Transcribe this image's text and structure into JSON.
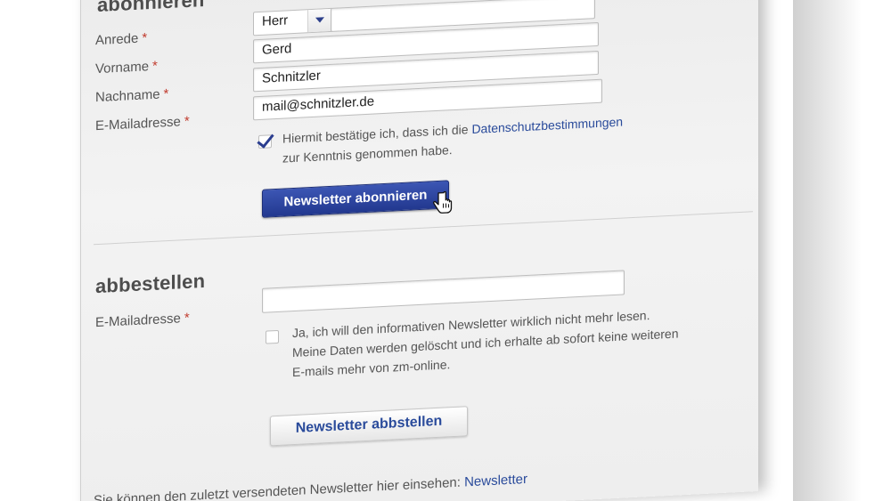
{
  "subscribe": {
    "title": "abonnieren",
    "salutation_label": "Anrede",
    "salutation_value": "Herr",
    "firstname_label": "Vorname",
    "firstname_value": "Gerd",
    "lastname_label": "Nachname",
    "lastname_value": "Schnitzler",
    "email_label": "E-Mailadresse",
    "email_value": "mail@schnitzler.de",
    "required_marker": "*",
    "privacy_text_1": "Hiermit bestätige ich, dass ich die",
    "privacy_link": "Datenschutzbestimmungen",
    "privacy_text_2": "zur Kenntnis genommen habe.",
    "privacy_checked": true,
    "button_label": "Newsletter abonnieren"
  },
  "unsubscribe": {
    "title": "abbestellen",
    "email_label": "E-Mailadresse",
    "email_value": "",
    "required_marker": "*",
    "confirm_line_1": "Ja, ich will den informativen Newsletter wirklich nicht mehr lesen.",
    "confirm_line_2": "Meine Daten werden gelöscht und ich erhalte ab sofort keine weiteren",
    "confirm_line_3": "E-mails mehr von zm-online.",
    "confirm_checked": false,
    "button_label": "Newsletter abbstellen"
  },
  "footer": {
    "text": "Sie können den zuletzt versendeten Newsletter hier einsehen:",
    "link": "Newsletter"
  },
  "colors": {
    "accent": "#2a3d8f",
    "link": "#2a4b9b",
    "required": "#c0392b"
  },
  "icons": {
    "cursor": "hand-pointer-icon",
    "dropdown": "chevron-down-icon",
    "check": "check-icon"
  }
}
